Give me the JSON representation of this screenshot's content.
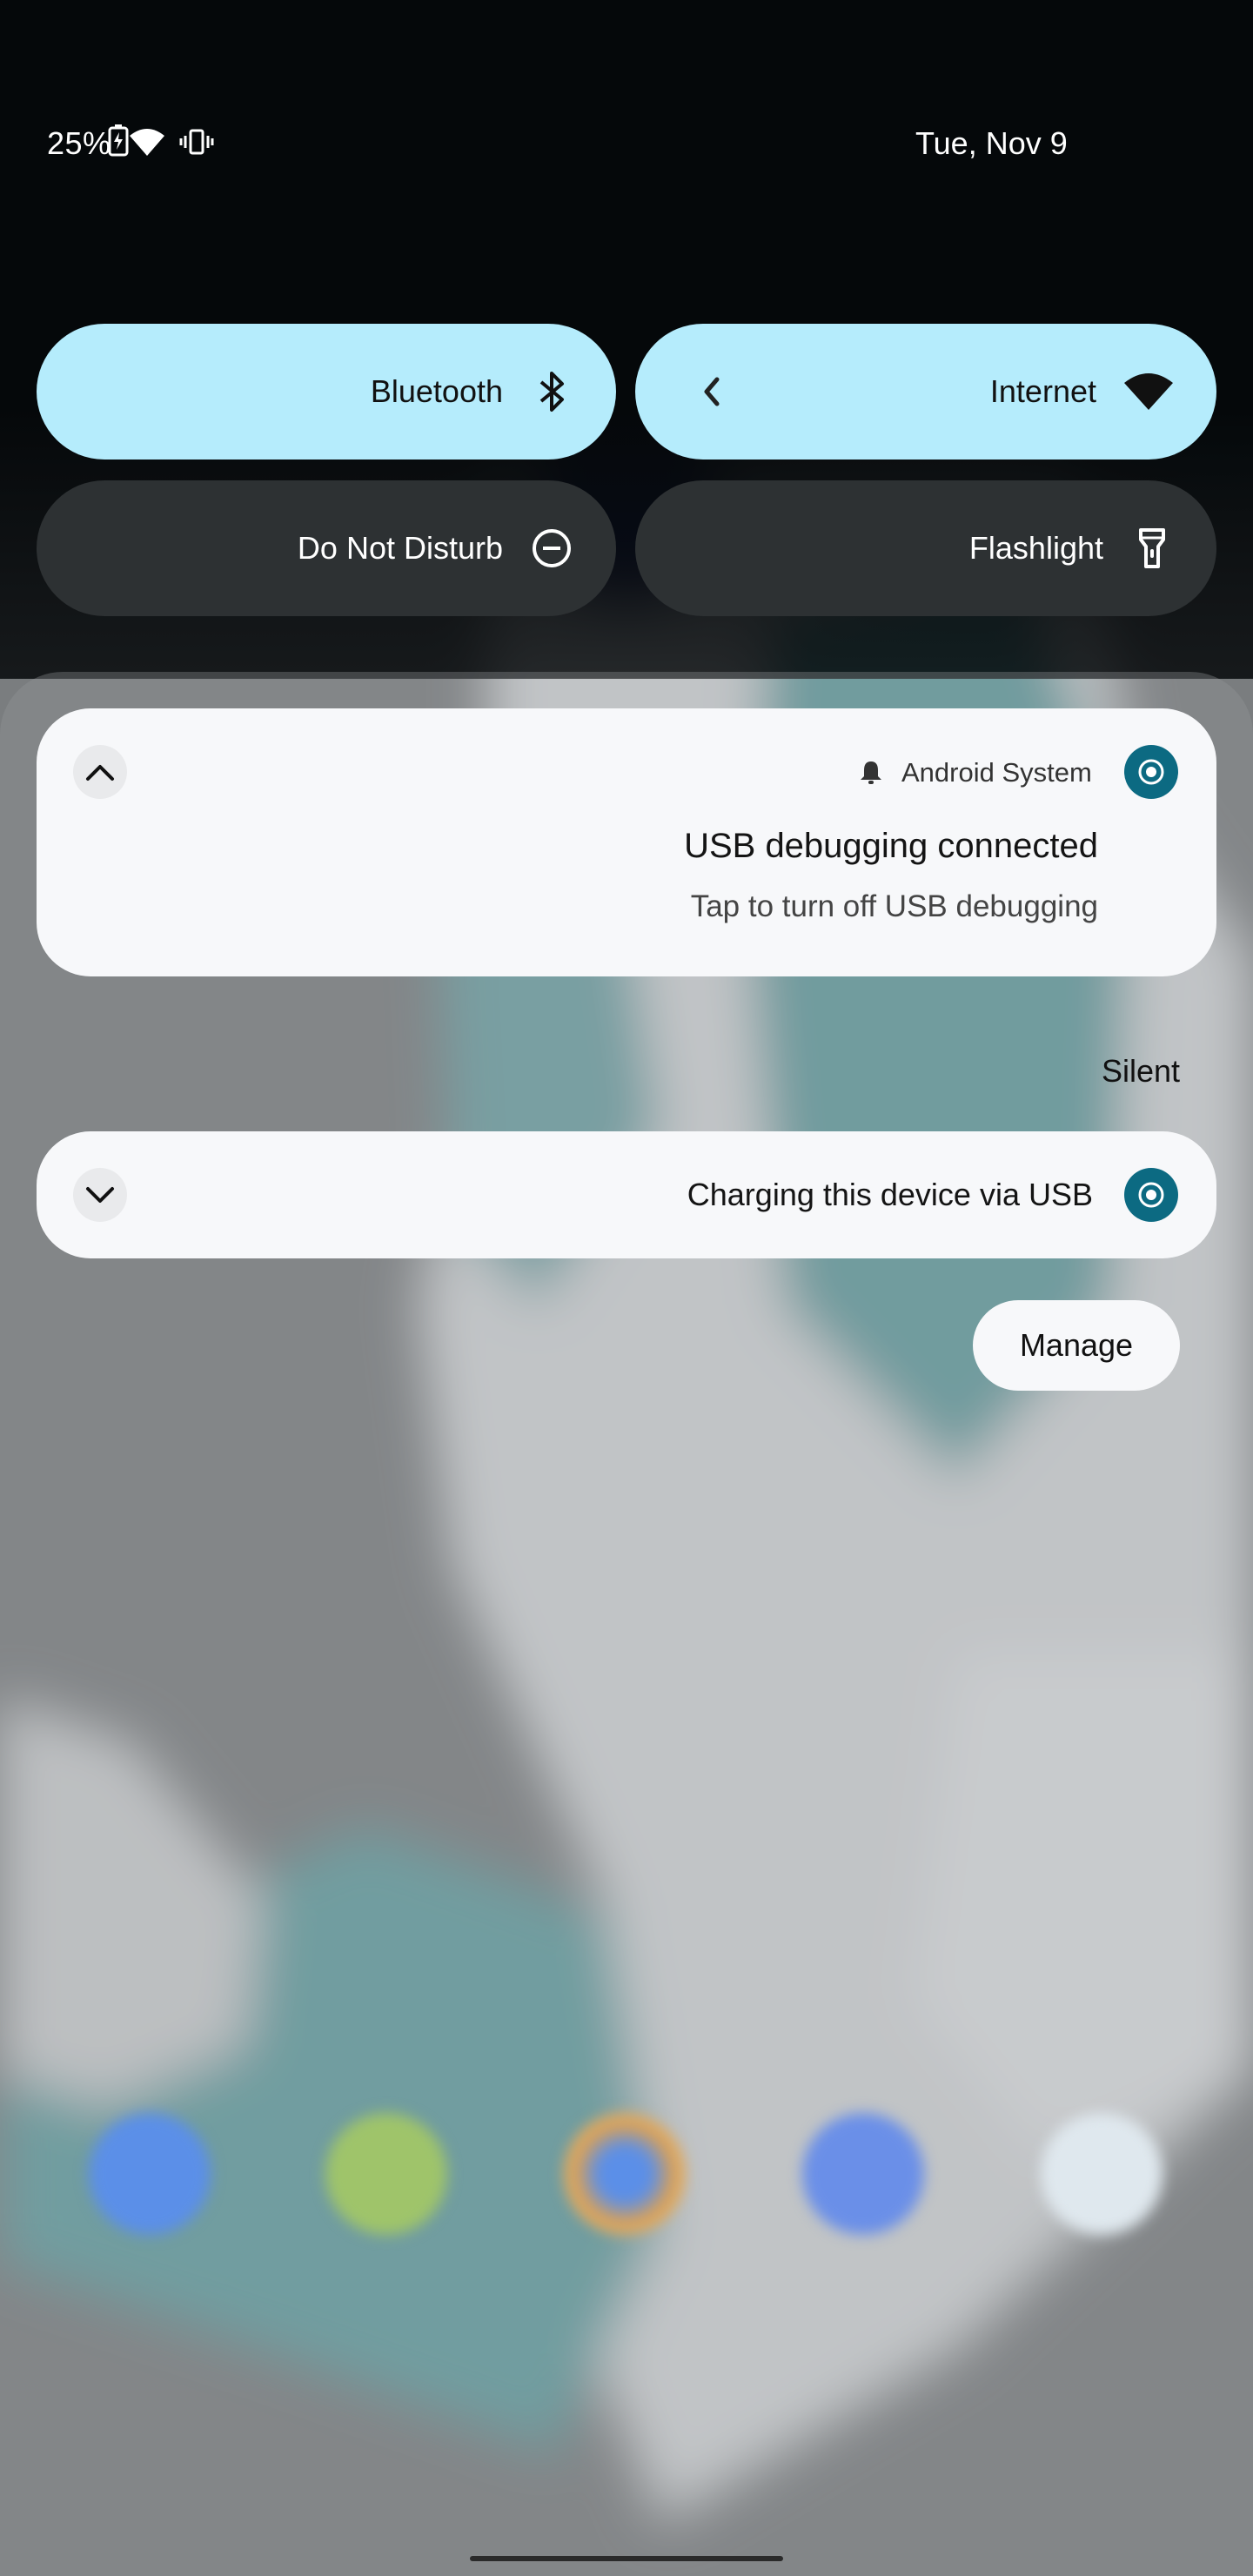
{
  "status_bar": {
    "battery": "25%",
    "date": "Tue, Nov 9",
    "icons": [
      "battery-charging-icon",
      "wifi-icon",
      "vibrate-icon"
    ]
  },
  "quick_settings": [
    {
      "label": "Bluetooth",
      "icon": "bluetooth-icon",
      "state": "on"
    },
    {
      "label": "Internet",
      "icon": "wifi-icon",
      "state": "on"
    },
    {
      "label": "Do Not Disturb",
      "icon": "do-not-disturb-icon",
      "state": "off"
    },
    {
      "label": "Flashlight",
      "icon": "flashlight-icon",
      "state": "off"
    }
  ],
  "notifications": {
    "usb_debugging": {
      "app": "Android System",
      "title": "USB debugging connected",
      "text": "Tap to turn off USB debugging"
    },
    "section_label": "Silent",
    "charging": {
      "title": "Charging this device via USB"
    },
    "manage_label": "Manage"
  },
  "colors": {
    "tile_on": "#b5ecfc",
    "tile_off": "#2d3133",
    "accent": "#0c6a82",
    "card": "#f7f8fa"
  }
}
